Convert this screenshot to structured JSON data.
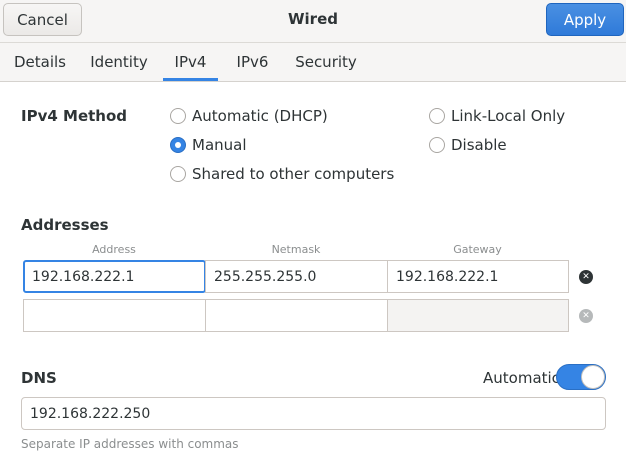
{
  "header": {
    "title": "Wired",
    "cancel_label": "Cancel",
    "apply_label": "Apply"
  },
  "tabs": [
    {
      "label": "Details"
    },
    {
      "label": "Identity"
    },
    {
      "label": "IPv4",
      "active": true
    },
    {
      "label": "IPv6"
    },
    {
      "label": "Security"
    }
  ],
  "ipv4_method": {
    "label": "IPv4 Method",
    "selected": "Manual",
    "options": [
      {
        "label": "Automatic (DHCP)"
      },
      {
        "label": "Manual"
      },
      {
        "label": "Shared to other computers"
      },
      {
        "label": "Link-Local Only"
      },
      {
        "label": "Disable"
      }
    ]
  },
  "addresses": {
    "label": "Addresses",
    "columns": [
      "Address",
      "Netmask",
      "Gateway"
    ],
    "rows": [
      {
        "address": "192.168.222.1",
        "netmask": "255.255.255.0",
        "gateway": "192.168.222.1"
      },
      {
        "address": "",
        "netmask": "",
        "gateway": ""
      }
    ]
  },
  "dns": {
    "label": "DNS",
    "automatic_label": "Automatic",
    "automatic": true,
    "value": "192.168.222.250",
    "hint": "Separate IP addresses with commas"
  },
  "colors": {
    "accent": "#3584e4",
    "headerbar": "#f6f5f4"
  }
}
